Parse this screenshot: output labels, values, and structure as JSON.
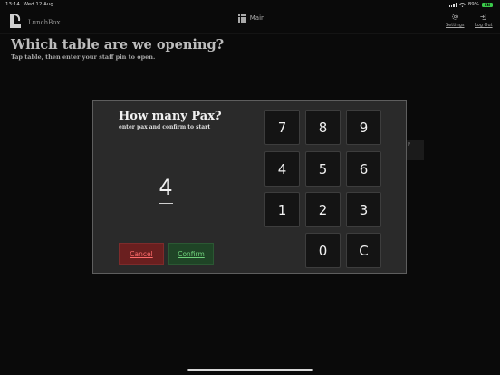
{
  "status_bar": {
    "time": "13:14",
    "date": "Wed 12 Aug",
    "battery": "89%",
    "battery_badge": "EN"
  },
  "header": {
    "brand": "LunchBox",
    "nav_main": "Main",
    "settings_label": "Settings",
    "logout_label": "Log Out"
  },
  "page": {
    "title": "Which table are we opening?",
    "subtitle": "Tap table, then enter your staff pin to open."
  },
  "background_hint": "P",
  "modal": {
    "title": "How many Pax?",
    "subtitle": "enter pax and confirm to start",
    "pax_value": "4",
    "cancel_label": "Cancel",
    "confirm_label": "Confirm"
  },
  "keypad": {
    "k7": "7",
    "k8": "8",
    "k9": "9",
    "k4": "4",
    "k5": "5",
    "k6": "6",
    "k1": "1",
    "k2": "2",
    "k3": "3",
    "k0": "0",
    "clear": "C"
  },
  "colors": {
    "background": "#0a0a0a",
    "modal": "#2a2a2a",
    "cancel_bg": "#6a1f1f",
    "cancel_text": "#ff6b6b",
    "confirm_bg": "#1f4426",
    "confirm_text": "#6ed07a"
  }
}
